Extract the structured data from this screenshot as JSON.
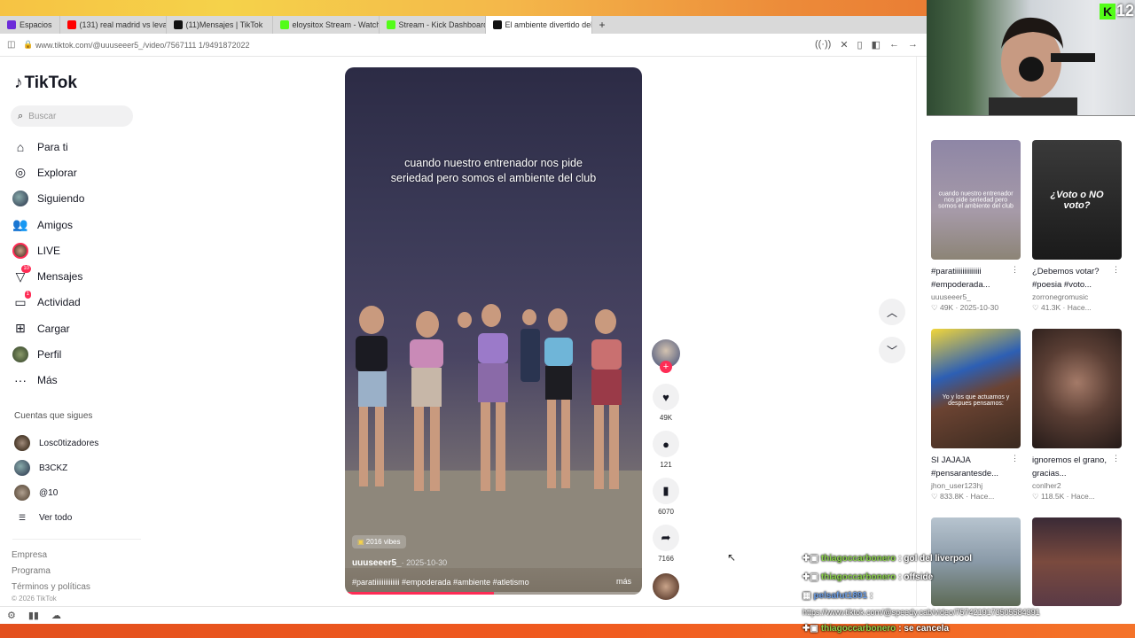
{
  "browser": {
    "tabs": [
      {
        "label": "Espacios",
        "color": "#6c2bd9"
      },
      {
        "label": "(131) real madrid vs levant",
        "color": "#ff0000"
      },
      {
        "label": "(11)Mensajes | TikTok",
        "color": "#111111"
      },
      {
        "label": "eloysitox Stream - Watch L",
        "color": "#53fc18"
      },
      {
        "label": "Stream - Kick Dashboard",
        "color": "#53fc18"
      },
      {
        "label": "El ambiente divertido del c",
        "color": "#111111"
      }
    ],
    "new_tab": "+",
    "url": "www.tiktok.com/@uuuseeer5_/video/7567111 1/9491872022"
  },
  "sidebar": {
    "logo": "TikTok",
    "search_placeholder": "Buscar",
    "nav": [
      {
        "label": "Para ti",
        "icon": "home-icon",
        "badge": ""
      },
      {
        "label": "Explorar",
        "icon": "compass-icon",
        "badge": ""
      },
      {
        "label": "Siguiendo",
        "icon": "following-avatar-icon",
        "badge": ""
      },
      {
        "label": "Amigos",
        "icon": "friends-icon",
        "badge": ""
      },
      {
        "label": "LIVE",
        "icon": "live-icon",
        "badge": ""
      },
      {
        "label": "Mensajes",
        "icon": "messages-icon",
        "badge": "10"
      },
      {
        "label": "Actividad",
        "icon": "activity-icon",
        "badge": "1"
      },
      {
        "label": "Cargar",
        "icon": "upload-icon",
        "badge": ""
      },
      {
        "label": "Perfil",
        "icon": "profile-avatar-icon",
        "badge": ""
      },
      {
        "label": "Más",
        "icon": "more-icon",
        "badge": ""
      }
    ],
    "following_title": "Cuentas que sigues",
    "following": [
      {
        "name": "Losc0tizadores"
      },
      {
        "name": "B3CKZ"
      },
      {
        "name": "@10"
      },
      {
        "name": "Ver todo"
      }
    ],
    "footer_links": [
      "Empresa",
      "Programa",
      "Términos y políticas"
    ],
    "copyright": "© 2026 TikTok"
  },
  "video": {
    "caption_line1": "cuando nuestro entrenador nos pide",
    "caption_line2": "seriedad pero somos el ambiente del club",
    "vibes": "2016 vibes",
    "author": "uuuseeer5_",
    "date": "· 2025-10-30",
    "hashtags": "#paratiiiiiiiiiiiiii #empoderada #ambiente #atletismo",
    "more": "más",
    "progress": 0.5
  },
  "actions": {
    "likes": "49K",
    "comments": "121",
    "saves": "6070",
    "shares": "7166"
  },
  "recommended": [
    {
      "title": "#paratiiiiiiiiiiiiii #empoderada...",
      "user": "uuuseeer5_",
      "stats": "♡ 49K · 2025-10-30",
      "overlay": "cuando nuestro entrenador nos pide seriedad pero somos el ambiente del club",
      "bg": "#7d7492"
    },
    {
      "title": "¿Debemos votar? #poesia #voto...",
      "user": "zorronegromusic",
      "stats": "♡ 41.3K · Hace...",
      "overlay": "¿Voto o NO voto?",
      "bg": "#2c2c2c"
    },
    {
      "title": "SI JAJAJA #pensarantesde...",
      "user": "jhon_user123hj",
      "stats": "♡ 833.8K · Hace...",
      "overlay": "Yo y los que actuamos y despues pensamos:",
      "bg": "#6b4332"
    },
    {
      "title": "ignoremos el grano, gracias...",
      "user": "conlher2",
      "stats": "♡ 118.5K · Hace...",
      "overlay": "",
      "bg": "#3a2a25"
    },
    {
      "title": "",
      "user": "",
      "stats": "",
      "overlay": "",
      "bg": "#8a9aa8"
    },
    {
      "title": "",
      "user": "",
      "stats": "",
      "overlay": "",
      "bg": "#5a3a46"
    }
  ],
  "stream": {
    "kick_logo": "K",
    "viewer_count": "12"
  },
  "chat": [
    {
      "user": "thiagoccarbonero",
      "msg": ": gol del liverpool"
    },
    {
      "user": "thiagoccarbonero",
      "msg": ": offside"
    },
    {
      "user": "pelsafut1891",
      "msg": ":"
    },
    {
      "user": "",
      "msg": "https://www.tiktok.com/@speedy.cab/video/7574219173505584391"
    },
    {
      "user": "thiagoccarbonero",
      "msg": ": se cancela"
    }
  ],
  "colors": {
    "tiktok_red": "#fe2c55",
    "kick_green": "#53fc18"
  }
}
